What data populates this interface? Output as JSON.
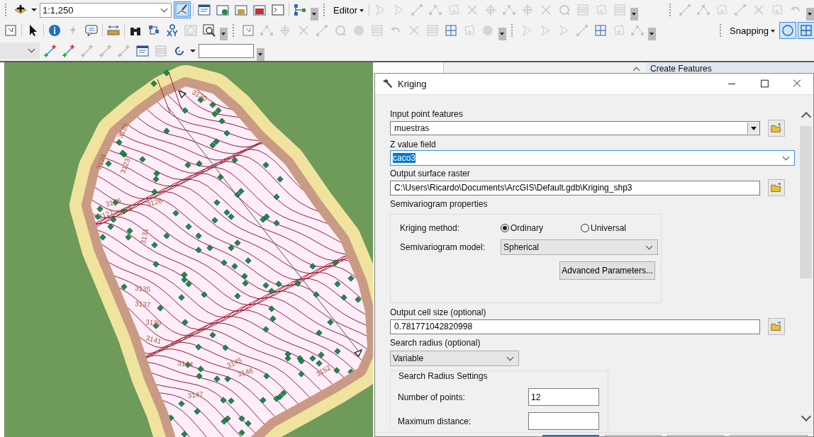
{
  "toolbar": {
    "scale": "1:1,250",
    "editor_menu": "Editor",
    "snapping_menu": "Snapping"
  },
  "map": {
    "contour_labels": [
      "3130",
      "3125",
      "3124",
      "3123",
      "3126",
      "3126",
      "3127",
      "3128",
      "3131",
      "3135",
      "3137",
      "3139",
      "3141",
      "3144",
      "3145",
      "3146",
      "3147",
      "3152"
    ]
  },
  "background_panel": {
    "title": "Create Features"
  },
  "dialog": {
    "title": "Kriging",
    "input_point_features": {
      "label": "Input point features",
      "value": "muestras"
    },
    "z_value_field": {
      "label": "Z value field",
      "value": "caco3",
      "selected": true
    },
    "output_surface_raster": {
      "label": "Output surface raster",
      "value": "C:\\Users\\Ricardo\\Documents\\ArcGIS\\Default.gdb\\Kriging_shp3"
    },
    "semivariogram": {
      "title": "Semivariogram properties",
      "method_label": "Kriging method:",
      "methods": [
        {
          "label": "Ordinary",
          "selected": true
        },
        {
          "label": "Universal",
          "selected": false
        }
      ],
      "model_label": "Semivariogram model:",
      "model": "Spherical",
      "advanced_button": "Advanced Parameters..."
    },
    "output_cell_size": {
      "label": "Output cell size (optional)",
      "value": "0.781771042820998"
    },
    "search_radius": {
      "label": "Search radius (optional)",
      "value": "Variable"
    },
    "search_radius_settings": {
      "title": "Search Radius Settings",
      "fields": [
        {
          "label": "Number of points:",
          "value": "12"
        },
        {
          "label": "Maximum distance:"
        }
      ]
    }
  }
}
